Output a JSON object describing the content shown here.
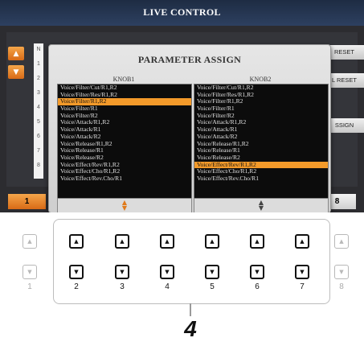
{
  "screen_title": "LIVE CONTROL",
  "background": {
    "row_numbers": [
      "N",
      "1",
      "2",
      "3",
      "4",
      "5",
      "6",
      "7",
      "8"
    ],
    "buttons": [
      "RESET",
      "L RESET",
      "SSIGN"
    ]
  },
  "dialog": {
    "title": "PARAMETER ASSIGN",
    "knob1": {
      "label": "KNOB1",
      "items": [
        "Voice/Filter/Cut/R1,R2",
        "Voice/Filter/Res/R1,R2",
        "Voice/Filter/R1,R2",
        "Voice/Filter/R1",
        "Voice/Filter/R2",
        "Voice/Attack/R1,R2",
        "Voice/Attack/R1",
        "Voice/Attack/R2",
        "Voice/Release/R1,R2",
        "Voice/Release/R1",
        "Voice/Release/R2",
        "Voice/Effect/Rev/R1,R2",
        "Voice/Effect/Cho/R1,R2",
        "Voice/Effect/Rev.Cho/R1"
      ],
      "selected_index": 2
    },
    "knob2": {
      "label": "KNOB2",
      "items": [
        "Voice/Filter/Cut/R1,R2",
        "Voice/Filter/Res/R1,R2",
        "Voice/Filter/R1,R2",
        "Voice/Filter/R1",
        "Voice/Filter/R2",
        "Voice/Attack/R1,R2",
        "Voice/Attack/R1",
        "Voice/Attack/R2",
        "Voice/Release/R1,R2",
        "Voice/Release/R1",
        "Voice/Release/R2",
        "Voice/Effect/Rev/R1,R2",
        "Voice/Effect/Cho/R1,R2",
        "Voice/Effect/Rev.Cho/R1"
      ],
      "selected_index": 11
    }
  },
  "tabs": {
    "left": "1",
    "right": "8"
  },
  "hardware": {
    "button_numbers": [
      "1",
      "2",
      "3",
      "4",
      "5",
      "6",
      "7",
      "8"
    ],
    "up_icon": "▲",
    "down_icon": "▼",
    "step_number": "4"
  },
  "colors": {
    "accent": "#f39a2a",
    "title_bar": "#263752",
    "list_bg": "#0c0c0c"
  }
}
